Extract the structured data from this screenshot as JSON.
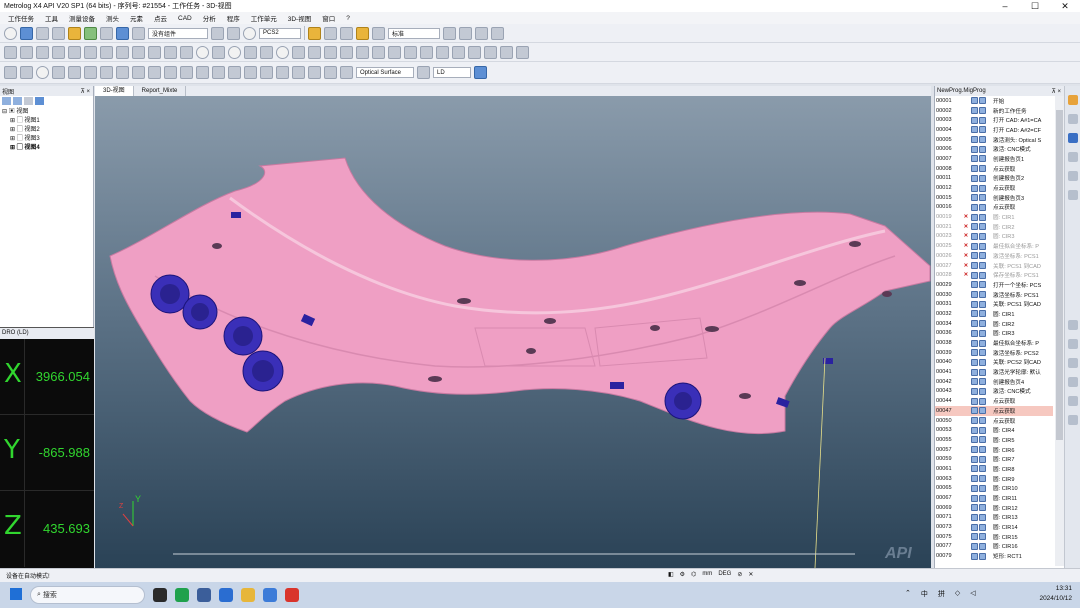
{
  "window": {
    "title": "Metrolog X4 API V20 SP1 (64 bits) - 序列号: #21554 - 工作任务 - 3D-视图"
  },
  "menu": [
    "工作任务",
    "工具",
    "测量设备",
    "测头",
    "元素",
    "点云",
    "CAD",
    "分析",
    "程序",
    "工作单元",
    "3D-视图",
    "窗口",
    "?"
  ],
  "toolbar": {
    "combo_part": "没有组件",
    "combo_pcs": "PCS2",
    "combo_std": "标准",
    "combo_surface": "Optical Surface",
    "combo_ld": "LD"
  },
  "left_panel": {
    "title": "视图",
    "root": "视图",
    "items": [
      "视图1",
      "视图2",
      "视图3",
      "视图4"
    ]
  },
  "dro": {
    "title": "DRO (LD)",
    "x_label": "X",
    "x_value": "3966.054",
    "y_label": "Y",
    "y_value": "-865.988",
    "z_label": "Z",
    "z_value": "435.693"
  },
  "tabs": [
    "3D-视图",
    "Report_Mixte"
  ],
  "view": {
    "logo": "API",
    "axis_z": "Z",
    "axis_y": "Y"
  },
  "program": {
    "title": "NewProg.MigProg",
    "rows": [
      {
        "n": "00001",
        "t": "开始",
        "m": ""
      },
      {
        "n": "00002",
        "t": "新的工作任务",
        "m": ""
      },
      {
        "n": "00003",
        "t": "打开 CAD: A#1=CA",
        "m": ""
      },
      {
        "n": "00004",
        "t": "打开 CAD: A#2=CF",
        "m": ""
      },
      {
        "n": "00005",
        "t": "激活测头: Optical S",
        "m": ""
      },
      {
        "n": "00006",
        "t": "激活: CNC模式",
        "m": ""
      },
      {
        "n": "00007",
        "t": "创建报告页1",
        "m": ""
      },
      {
        "n": "00008",
        "t": "点云获取",
        "m": ""
      },
      {
        "n": "00011",
        "t": "创建报告页2",
        "m": ""
      },
      {
        "n": "00012",
        "t": "点云获取",
        "m": ""
      },
      {
        "n": "00015",
        "t": "创建报告页3",
        "m": ""
      },
      {
        "n": "00016",
        "t": "点云获取",
        "m": ""
      },
      {
        "n": "00019",
        "t": "圆: CIR1",
        "m": "✕",
        "d": true
      },
      {
        "n": "00021",
        "t": "圆: CIR2",
        "m": "✕",
        "d": true
      },
      {
        "n": "00023",
        "t": "圆: CIR3",
        "m": "✕",
        "d": true
      },
      {
        "n": "00025",
        "t": "最佳拟合坐标系: P",
        "m": "✕",
        "d": true
      },
      {
        "n": "00026",
        "t": "激活坐标系: PCS1",
        "m": "✕",
        "d": true
      },
      {
        "n": "00027",
        "t": "关联: PCS1 到CAD",
        "m": "✕",
        "d": true
      },
      {
        "n": "00028",
        "t": "保存坐标系: PCS1",
        "m": "✕",
        "d": true
      },
      {
        "n": "00029",
        "t": "打开一个坐标: PCS",
        "m": ""
      },
      {
        "n": "00030",
        "t": "激活坐标系: PCS1",
        "m": ""
      },
      {
        "n": "00031",
        "t": "关联: PCS1 到CAD",
        "m": ""
      },
      {
        "n": "00032",
        "t": "圆: CIR1",
        "m": ""
      },
      {
        "n": "00034",
        "t": "圆: CIR2",
        "m": ""
      },
      {
        "n": "00036",
        "t": "圆: CIR3",
        "m": ""
      },
      {
        "n": "00038",
        "t": "最佳拟合坐标系: P",
        "m": ""
      },
      {
        "n": "00039",
        "t": "激活坐标系: PCS2",
        "m": ""
      },
      {
        "n": "00040",
        "t": "关联: PCS2 到CAD",
        "m": ""
      },
      {
        "n": "00041",
        "t": "激活光学轮廓: 默认",
        "m": ""
      },
      {
        "n": "00042",
        "t": "创建报告页4",
        "m": ""
      },
      {
        "n": "00043",
        "t": "激活: CNC模式",
        "m": ""
      },
      {
        "n": "00044",
        "t": "点云获取",
        "m": ""
      },
      {
        "n": "00047",
        "t": "点云获取",
        "m": "",
        "h": true
      },
      {
        "n": "00050",
        "t": "点云获取",
        "m": ""
      },
      {
        "n": "00053",
        "t": "圆: CIR4",
        "m": ""
      },
      {
        "n": "00055",
        "t": "圆: CIR5",
        "m": ""
      },
      {
        "n": "00057",
        "t": "圆: CIR6",
        "m": ""
      },
      {
        "n": "00059",
        "t": "圆: CIR7",
        "m": ""
      },
      {
        "n": "00061",
        "t": "圆: CIR8",
        "m": ""
      },
      {
        "n": "00063",
        "t": "圆: CIR9",
        "m": ""
      },
      {
        "n": "00065",
        "t": "圆: CIR10",
        "m": ""
      },
      {
        "n": "00067",
        "t": "圆: CIR11",
        "m": ""
      },
      {
        "n": "00069",
        "t": "圆: CIR12",
        "m": ""
      },
      {
        "n": "00071",
        "t": "圆: CIR13",
        "m": ""
      },
      {
        "n": "00073",
        "t": "圆: CIR14",
        "m": ""
      },
      {
        "n": "00075",
        "t": "圆: CIR15",
        "m": ""
      },
      {
        "n": "00077",
        "t": "圆: CIR16",
        "m": ""
      },
      {
        "n": "00079",
        "t": "矩形: RCT1",
        "m": ""
      }
    ]
  },
  "status": {
    "left": "设备在自动模式!",
    "mm": "mm",
    "deg": "DEG"
  },
  "taskbar": {
    "search": "搜索",
    "time": "13:31",
    "date": "2024/10/12",
    "ime1": "中",
    "ime2": "拼"
  }
}
